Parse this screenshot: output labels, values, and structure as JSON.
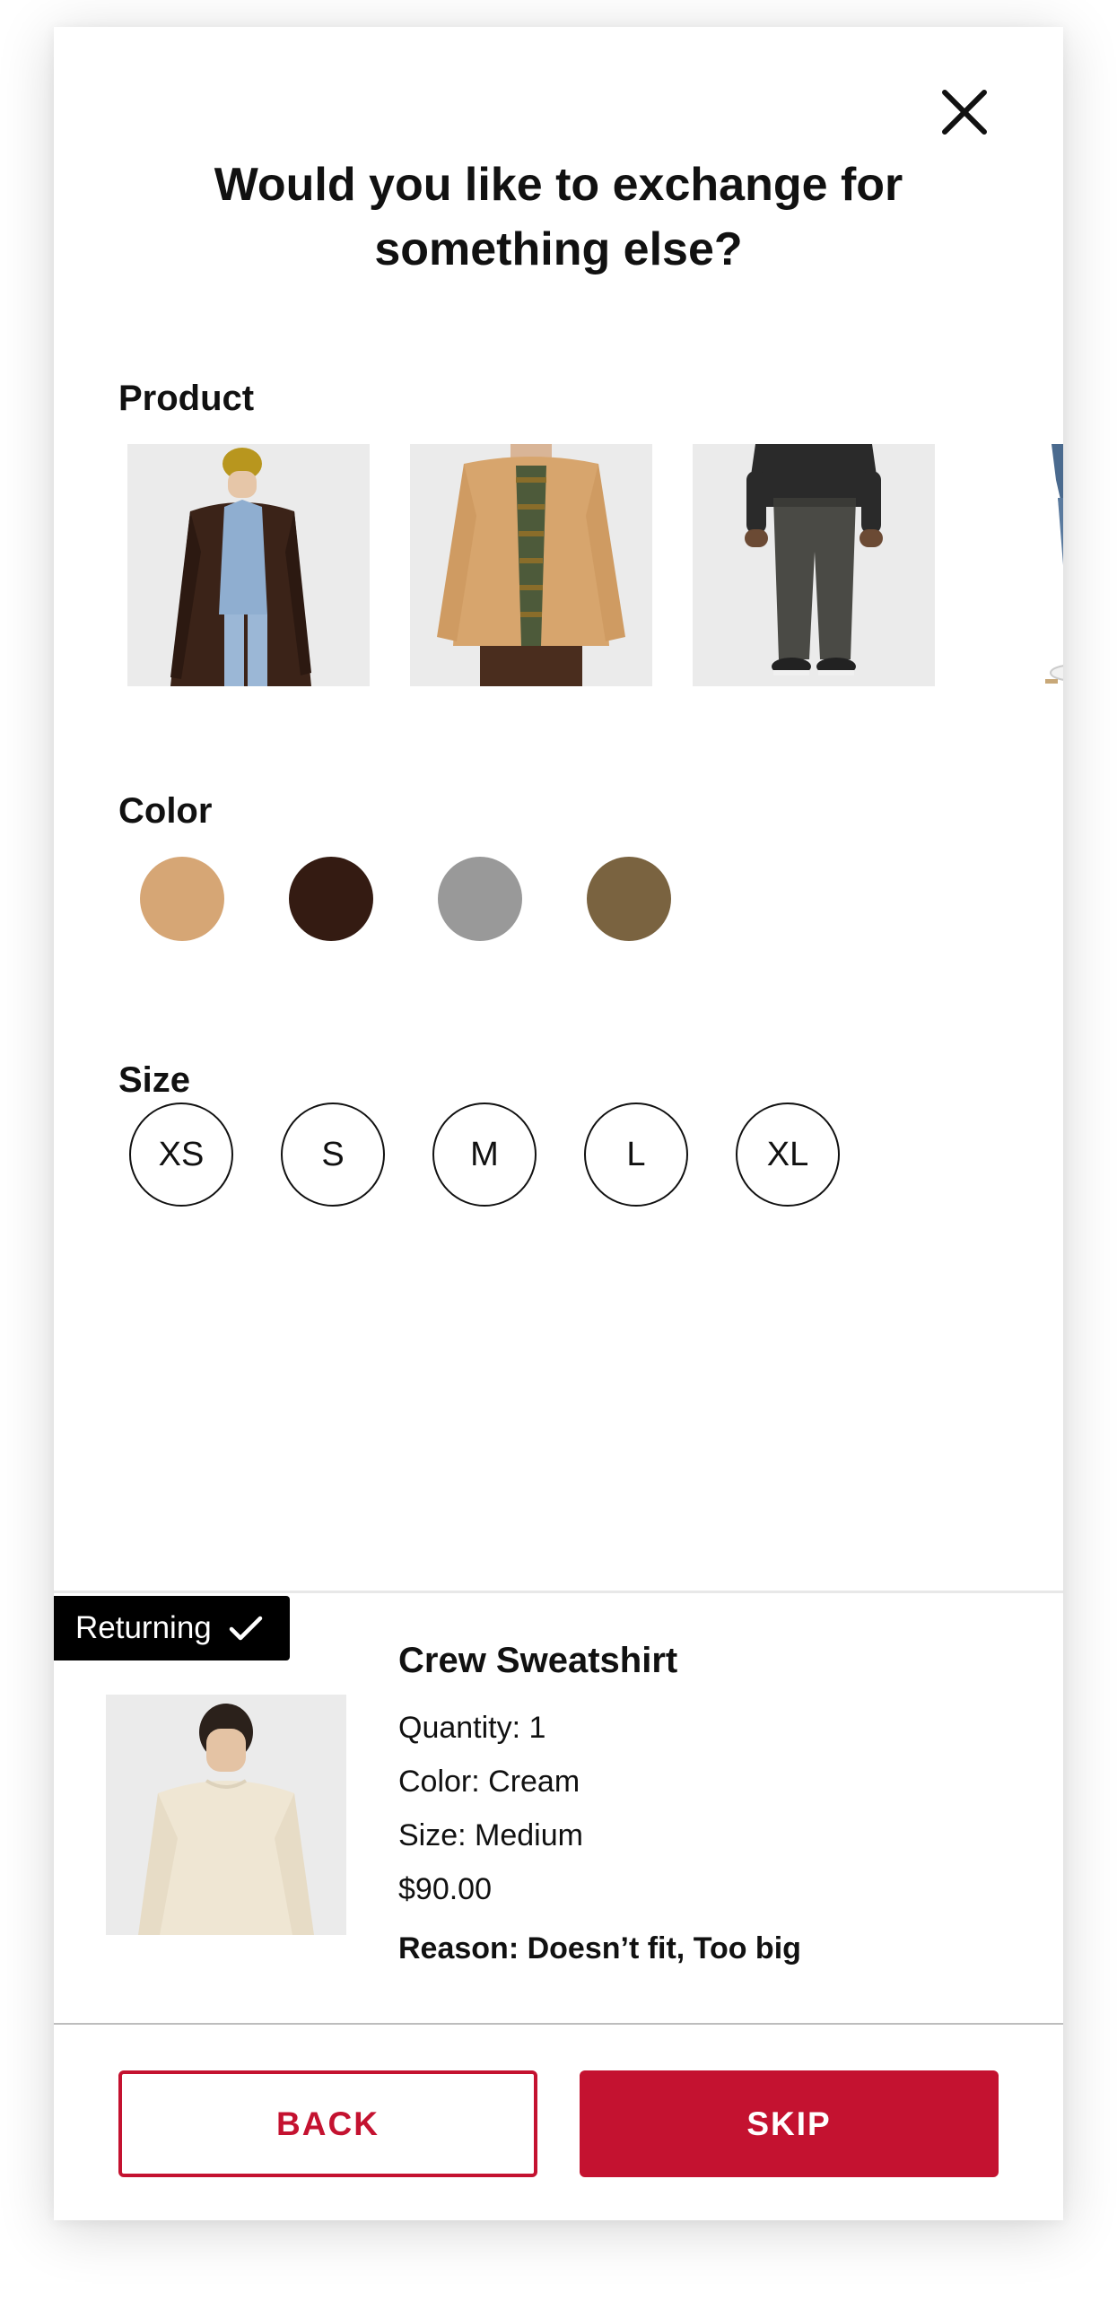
{
  "dialog": {
    "title_line1": "Would you like to exchange for",
    "title_line2": "something else?"
  },
  "sections": {
    "product_label": "Product",
    "color_label": "Color",
    "size_label": "Size"
  },
  "products": [
    {
      "icon": "long-brown-coat-image"
    },
    {
      "icon": "tan-western-shirt-image"
    },
    {
      "icon": "dark-gray-pants-image"
    },
    {
      "icon": "blue-jeans-partial-image"
    }
  ],
  "colors": [
    {
      "name": "tan",
      "hex": "#D6A675"
    },
    {
      "name": "dark-brown",
      "hex": "#341B12"
    },
    {
      "name": "gray",
      "hex": "#999999"
    },
    {
      "name": "olive-brown",
      "hex": "#7A6340"
    }
  ],
  "sizes": [
    "XS",
    "S",
    "M",
    "L",
    "XL"
  ],
  "returning": {
    "badge": "Returning",
    "item_name": "Crew Sweatshirt",
    "quantity": "Quantity: 1",
    "color": "Color: Cream",
    "size": "Size: Medium",
    "price": "$90.00",
    "reason": "Reason: Doesn’t fit, Too big"
  },
  "actions": {
    "back": "BACK",
    "skip": "SKIP"
  },
  "theme": {
    "accent": "#C41230"
  }
}
